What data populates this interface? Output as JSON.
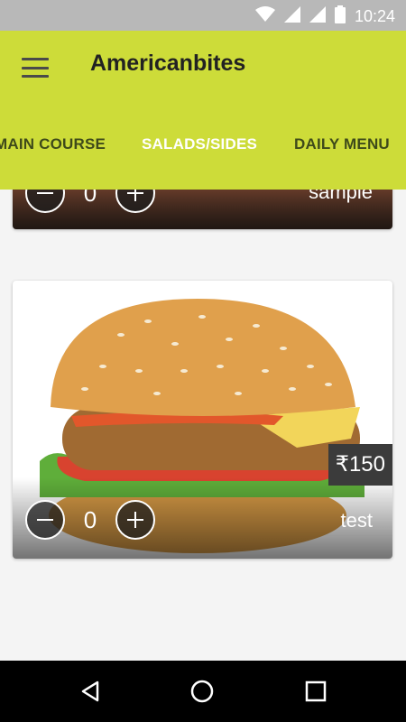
{
  "status_bar": {
    "time": "10:24"
  },
  "app": {
    "title": "Americanbites"
  },
  "tabs": [
    {
      "label": "MAIN COURSE",
      "active": false
    },
    {
      "label": "SALADS/SIDES",
      "active": true
    },
    {
      "label": "DAILY MENU",
      "active": false
    }
  ],
  "items": [
    {
      "name": "sample",
      "quantity": "0"
    },
    {
      "name": "test",
      "quantity": "0",
      "price": "₹150"
    }
  ],
  "colors": {
    "appbar": "#cddc39",
    "active_tab": "#ffffff",
    "inactive_tab": "#3e4a1a",
    "status_bar": "#b8b8b8"
  },
  "icons": [
    "menu-icon",
    "wifi-icon",
    "signal-icon",
    "battery-icon",
    "minus-icon",
    "plus-icon",
    "back-icon",
    "home-icon",
    "recents-icon"
  ]
}
